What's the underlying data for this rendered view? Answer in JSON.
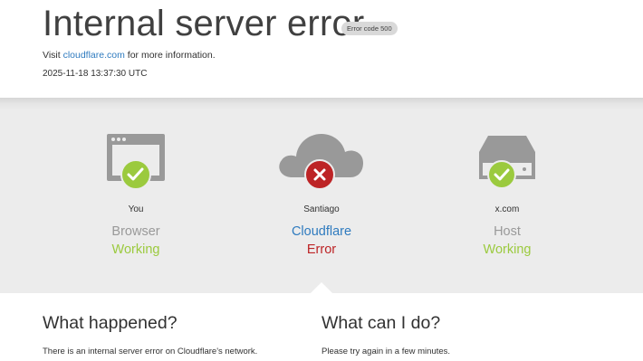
{
  "header": {
    "title": "Internal server error",
    "error_badge": "Error code 500",
    "visit_prefix": "Visit",
    "visit_link": "cloudflare.com",
    "visit_suffix": "for more information.",
    "timestamp": "2025-11-18 13:37:30 UTC"
  },
  "status": [
    {
      "location": "You",
      "name": "Browser",
      "state": "Working",
      "icon": "browser-icon",
      "badge": "check-icon"
    },
    {
      "location": "Santiago",
      "name": "Cloudflare",
      "state": "Error",
      "icon": "cloud-icon",
      "badge": "error-x-icon"
    },
    {
      "location": "x.com",
      "name": "Host",
      "state": "Working",
      "icon": "server-icon",
      "badge": "check-icon"
    }
  ],
  "what_happened": {
    "heading": "What happened?",
    "body": "There is an internal server error on Cloudflare's network."
  },
  "what_can_i_do": {
    "heading": "What can I do?",
    "body": "Please try again in a few minutes."
  },
  "colors": {
    "ok": "#9bca3e",
    "error": "#bd2426",
    "link": "#2f7bbf",
    "icon_grey": "#999999"
  }
}
